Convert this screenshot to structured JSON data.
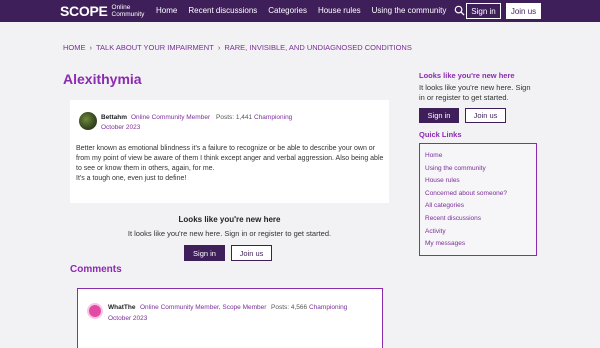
{
  "header": {
    "logo_main": "SCOPE",
    "logo_sub_1": "Online",
    "logo_sub_2": "Community",
    "nav": [
      "Home",
      "Recent discussions",
      "Categories",
      "House rules",
      "Using the community"
    ],
    "signin_label": "Sign in",
    "join_label": "Join us",
    "search_icon": "search-icon"
  },
  "breadcrumb": [
    "HOME",
    "TALK ABOUT YOUR IMPAIRMENT",
    "RARE, INVISIBLE, AND UNDIAGNOSED CONDITIONS"
  ],
  "breadcrumb_sep": "›",
  "page_title": "Alexithymia",
  "post": {
    "author": "Bettahm",
    "role": "Online Community Member",
    "posts": "Posts: 1,441",
    "rank": "Championing",
    "date": "October 2023",
    "body_1": "Better known as emotional blindness it's a failure to recognize or be able to describe your own or from my point of view be aware of them I think except anger and verbal aggression. Also being able to see or know them in others, again, for me.",
    "body_2": "It's a tough one, even just to define!"
  },
  "prompt": {
    "title": "Looks like you're new here",
    "text": "It looks like you're new here. Sign in or register to get started.",
    "signin_label": "Sign in",
    "join_label": "Join us"
  },
  "comments_title": "Comments",
  "comment": {
    "author": "WhatThe",
    "role": "Online Community Member, Scope Member",
    "posts": "Posts: 4,566",
    "rank": "Championing",
    "date": "October 2023"
  },
  "sidebar": {
    "title": "Looks like you're new here",
    "text": "It looks like you're new here. Sign in or register to get started.",
    "signin_label": "Sign in",
    "join_label": "Join us",
    "quick_links_title": "Quick Links",
    "quick_links": [
      "Home",
      "Using the community",
      "House rules",
      "Concerned about someone?",
      "All categories",
      "Recent discussions",
      "Activity",
      "My messages"
    ]
  },
  "colors": {
    "brand": "#3f1f5a",
    "accent": "#8a2bb0"
  }
}
